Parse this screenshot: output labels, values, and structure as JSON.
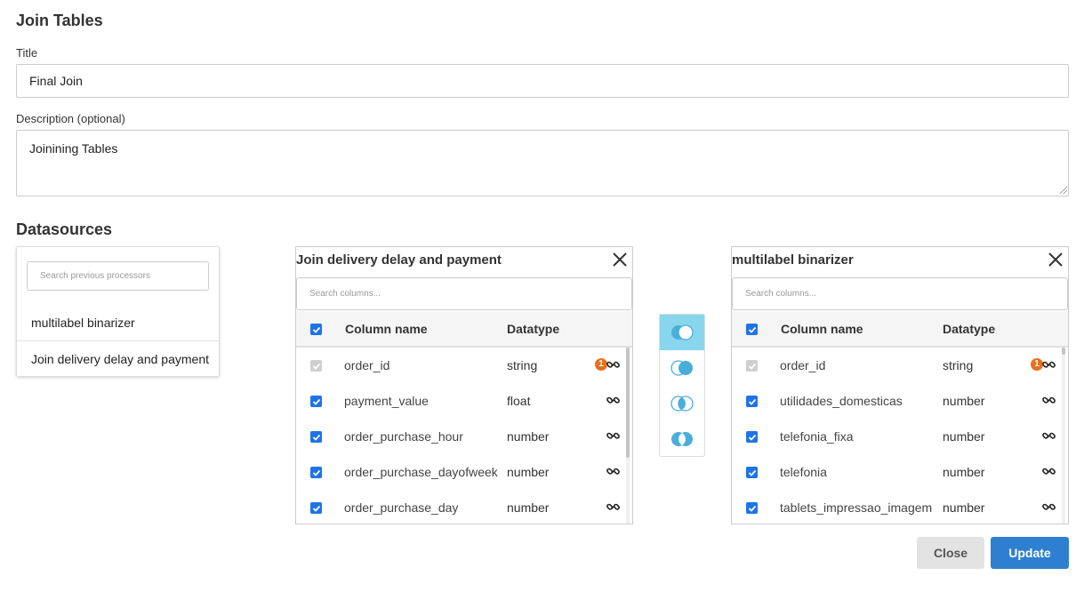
{
  "page": {
    "heading": "Join Tables",
    "title_label": "Title",
    "title_value": "Final Join",
    "description_label": "Description (optional)",
    "description_value": "Joinining Tables",
    "datasources_heading": "Datasources"
  },
  "datasources": {
    "search_placeholder": "Search previous processors",
    "items": [
      {
        "label": "multilabel binarizer"
      },
      {
        "label": "Join delivery delay and payment"
      }
    ]
  },
  "panels": [
    {
      "title": "Join delivery delay and payment",
      "search_placeholder": "Search columns...",
      "col_name_header": "Column name",
      "col_type_header": "Datatype",
      "rows": [
        {
          "name": "order_id",
          "type": "string",
          "checked": true,
          "disabled": true,
          "badge": "1"
        },
        {
          "name": "payment_value",
          "type": "float",
          "checked": true,
          "disabled": false,
          "badge": ""
        },
        {
          "name": "order_purchase_hour",
          "type": "number",
          "checked": true,
          "disabled": false,
          "badge": ""
        },
        {
          "name": "order_purchase_dayofweek",
          "type": "number",
          "checked": true,
          "disabled": false,
          "badge": ""
        },
        {
          "name": "order_purchase_day",
          "type": "number",
          "checked": true,
          "disabled": false,
          "badge": ""
        }
      ]
    },
    {
      "title": "multilabel binarizer",
      "search_placeholder": "Search columns...",
      "col_name_header": "Column name",
      "col_type_header": "Datatype",
      "rows": [
        {
          "name": "order_id",
          "type": "string",
          "checked": true,
          "disabled": true,
          "badge": "1"
        },
        {
          "name": "utilidades_domesticas",
          "type": "number",
          "checked": true,
          "disabled": false,
          "badge": ""
        },
        {
          "name": "telefonia_fixa",
          "type": "number",
          "checked": true,
          "disabled": false,
          "badge": ""
        },
        {
          "name": "telefonia",
          "type": "number",
          "checked": true,
          "disabled": false,
          "badge": ""
        },
        {
          "name": "tablets_impressao_imagem",
          "type": "number",
          "checked": true,
          "disabled": false,
          "badge": ""
        }
      ]
    }
  ],
  "join_types": [
    {
      "icon": "left-join-icon",
      "active": true
    },
    {
      "icon": "right-join-icon",
      "active": false
    },
    {
      "icon": "inner-join-icon",
      "active": false
    },
    {
      "icon": "outer-join-icon",
      "active": false
    }
  ],
  "buttons": {
    "close_label": "Close",
    "update_label": "Update"
  },
  "colors": {
    "primary": "#2f7fd0",
    "checkbox": "#1e73e8",
    "badge": "#e8701e",
    "join_active": "#88d6ee",
    "join_fill": "#4aaedb"
  }
}
